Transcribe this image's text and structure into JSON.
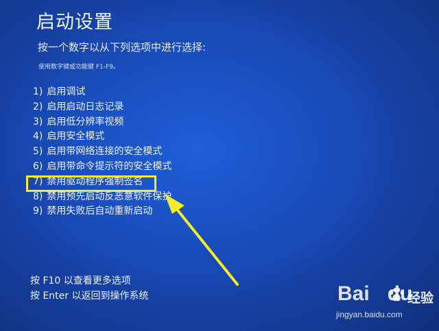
{
  "screen": {
    "title": "启动设置",
    "subtitle": "按一个数字以从下列选项中进行选择:",
    "hint": "使用数字键或功能键 F1-F9。"
  },
  "options": [
    {
      "number": "1)",
      "label": "启用调试"
    },
    {
      "number": "2)",
      "label": "启用启动日志记录"
    },
    {
      "number": "3)",
      "label": "启用低分辨率视频"
    },
    {
      "number": "4)",
      "label": "启用安全模式"
    },
    {
      "number": "5)",
      "label": "启用带网络连接的安全模式"
    },
    {
      "number": "6)",
      "label": "启用带命令提示符的安全模式"
    },
    {
      "number": "7)",
      "label": "禁用驱动程序强制签名"
    },
    {
      "number": "8)",
      "label": "禁用预先启动反恶意软件保护"
    },
    {
      "number": "9)",
      "label": "禁用失败后自动重新启动"
    }
  ],
  "footer": {
    "more_options": "按 F10 以查看更多选项",
    "return_os": "按 Enter 以返回到操作系统"
  },
  "annotation": {
    "highlight_color": "#f4ee2a",
    "highlighted_option": "7)"
  },
  "watermark": {
    "logo": "Bai",
    "logo_suffix": "du",
    "brand_cn": "经验",
    "url": "jingyan.baidu.com"
  },
  "colors": {
    "background": "#1a4fc0",
    "text": "#eef3ff",
    "annotation": "#f4ee2a"
  }
}
